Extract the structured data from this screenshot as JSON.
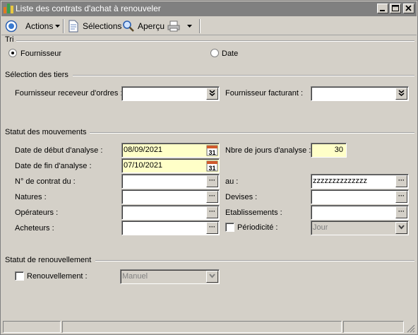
{
  "window": {
    "title": "Liste des contrats d'achat à renouveler"
  },
  "toolbar": {
    "actions_label": "Actions",
    "selections_label": "Sélections",
    "apercu_label": "Aperçu"
  },
  "tri": {
    "title": "Tri",
    "option_fournisseur": "Fournisseur",
    "option_date": "Date",
    "selected": "Fournisseur"
  },
  "tiers": {
    "title": "Sélection des tiers",
    "fournisseur_receveur_label": "Fournisseur receveur d'ordres :",
    "fournisseur_receveur_value": "",
    "fournisseur_facturant_label": "Fournisseur facturant :",
    "fournisseur_facturant_value": ""
  },
  "mouvements": {
    "title": "Statut des mouvements",
    "date_debut_label": "Date de début d'analyse :",
    "date_debut_value": "08/09/2021",
    "date_fin_label": "Date de fin d'analyse :",
    "date_fin_value": "07/10/2021",
    "nbre_jours_label": "Nbre de jours d'analyse :",
    "nbre_jours_value": "30",
    "calendar_day": "31",
    "contrat_du_label": "N° de contrat du :",
    "contrat_du_value": "",
    "au_label": "au :",
    "au_value": "zzzzzzzzzzzzzz",
    "natures_label": "Natures :",
    "natures_value": "",
    "devises_label": "Devises :",
    "devises_value": "",
    "operateurs_label": "Opérateurs :",
    "operateurs_value": "",
    "etablissements_label": "Etablissements :",
    "etablissements_value": "",
    "acheteurs_label": "Acheteurs :",
    "acheteurs_value": "",
    "periodicite_label": "Périodicité :",
    "periodicite_value": "Jour",
    "periodicite_checked": false
  },
  "renouvellement": {
    "title": "Statut de renouvellement",
    "renouvellement_label": "Renouvellement :",
    "renouvellement_checked": false,
    "mode_value": "Manuel"
  },
  "colors": {
    "title_bar": "#808080",
    "date_fill": "#ffffc8",
    "face": "#d4d0c8"
  }
}
